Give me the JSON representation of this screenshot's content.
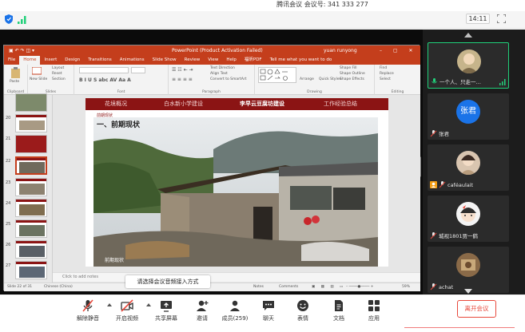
{
  "meeting": {
    "id_text": "腾讯会议 会议号: 341 333 277",
    "clock": "14:11"
  },
  "ppt": {
    "title": "PowerPoint (Product Activation Failed)",
    "user": "yuan runyong",
    "tabs": [
      "File",
      "Home",
      "Insert",
      "Design",
      "Transitions",
      "Animations",
      "Slide Show",
      "Review",
      "View",
      "Help",
      "福昕PDF",
      "Tell me what you want to do"
    ],
    "ribbon": {
      "groups": [
        "Clipboard",
        "Slides",
        "Font",
        "Paragraph",
        "Drawing",
        "Editing"
      ],
      "paste": "Paste",
      "new_slide": "New Slide",
      "layout": "Layout",
      "reset": "Reset",
      "section": "Section",
      "text_direction": "Text Direction",
      "align_text": "Align Text",
      "convert": "Convert to SmartArt",
      "arrange": "Arrange",
      "quick_styles": "Quick Styles",
      "shape_fill": "Shape Fill",
      "shape_outline": "Shape Outline",
      "shape_effects": "Shape Effects",
      "find": "Find",
      "replace": "Replace",
      "select": "Select"
    },
    "slide_numbers": [
      "20",
      "21",
      "22",
      "23",
      "24",
      "25",
      "26",
      "27"
    ],
    "selected_slide": "22",
    "slide": {
      "nav": [
        "花境概况",
        "白水新小学建设",
        "李早云豆腐坊建设",
        "工作经验总结"
      ],
      "current_nav": "李早云豆腐坊建设",
      "heading": "一、前期现状",
      "tag": "前期现状"
    },
    "notes_placeholder": "Click to add notes",
    "status_left": "Slide 22 of 31",
    "status_lang": "Chinese (China)",
    "status_notes": "Notes",
    "status_comments": "Comments",
    "zoom": "59%"
  },
  "audio_tip": "请选择会议音频接入方式",
  "participants": [
    {
      "name": "一个人、只走一…",
      "kind": "photo",
      "active": true
    },
    {
      "name": "张君",
      "kind": "text",
      "initials": "张君",
      "active": false
    },
    {
      "name": "caféaulait",
      "kind": "photo",
      "active": false
    },
    {
      "name": "城视1801贾一鹤",
      "kind": "cartoon",
      "active": false
    },
    {
      "name": "achat",
      "kind": "photo",
      "active": false
    }
  ],
  "toolbar": {
    "unmute": "解除静音",
    "video": "开启视频",
    "share": "共享屏幕",
    "invite": "邀请",
    "members": "成员(259)",
    "chat": "聊天",
    "reactions": "表情",
    "docs": "文档",
    "apps": "应用",
    "leave": "离开会议"
  },
  "colors": {
    "ppt_red": "#c43e1c",
    "nav_red": "#8b1414",
    "active_green": "#21d07a",
    "leave_red": "#e8483b",
    "avatar_blue": "#1a73e8"
  }
}
